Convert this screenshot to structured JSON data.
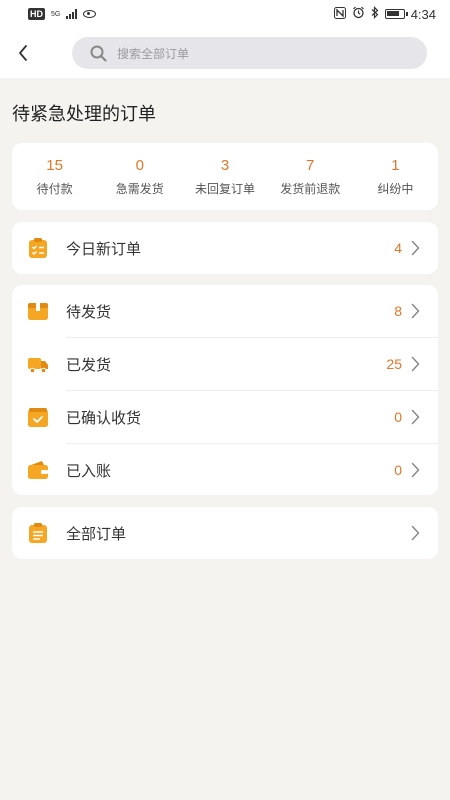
{
  "status_bar": {
    "left_badge": "HD",
    "network": "5G",
    "time": "4:34"
  },
  "header": {
    "search_placeholder": "搜索全部订单"
  },
  "section_title": "待紧急处理的订单",
  "stats": [
    {
      "value": "15",
      "label": "待付款"
    },
    {
      "value": "0",
      "label": "急需发货"
    },
    {
      "value": "3",
      "label": "未回复订单"
    },
    {
      "value": "7",
      "label": "发货前退款"
    },
    {
      "value": "1",
      "label": "纠纷中"
    }
  ],
  "today": {
    "label": "今日新订单",
    "count": "4",
    "icon": "clipboard-check-icon"
  },
  "orders": [
    {
      "label": "待发货",
      "count": "8",
      "icon": "box-icon"
    },
    {
      "label": "已发货",
      "count": "25",
      "icon": "truck-icon"
    },
    {
      "label": "已确认收货",
      "count": "0",
      "icon": "received-box-icon"
    },
    {
      "label": "已入账",
      "count": "0",
      "icon": "wallet-icon"
    }
  ],
  "all_orders": {
    "label": "全部订单",
    "icon": "order-list-icon"
  },
  "colors": {
    "accent": "#e0772a",
    "icon_orange": "#f5a623",
    "background": "#f4f3f0"
  }
}
